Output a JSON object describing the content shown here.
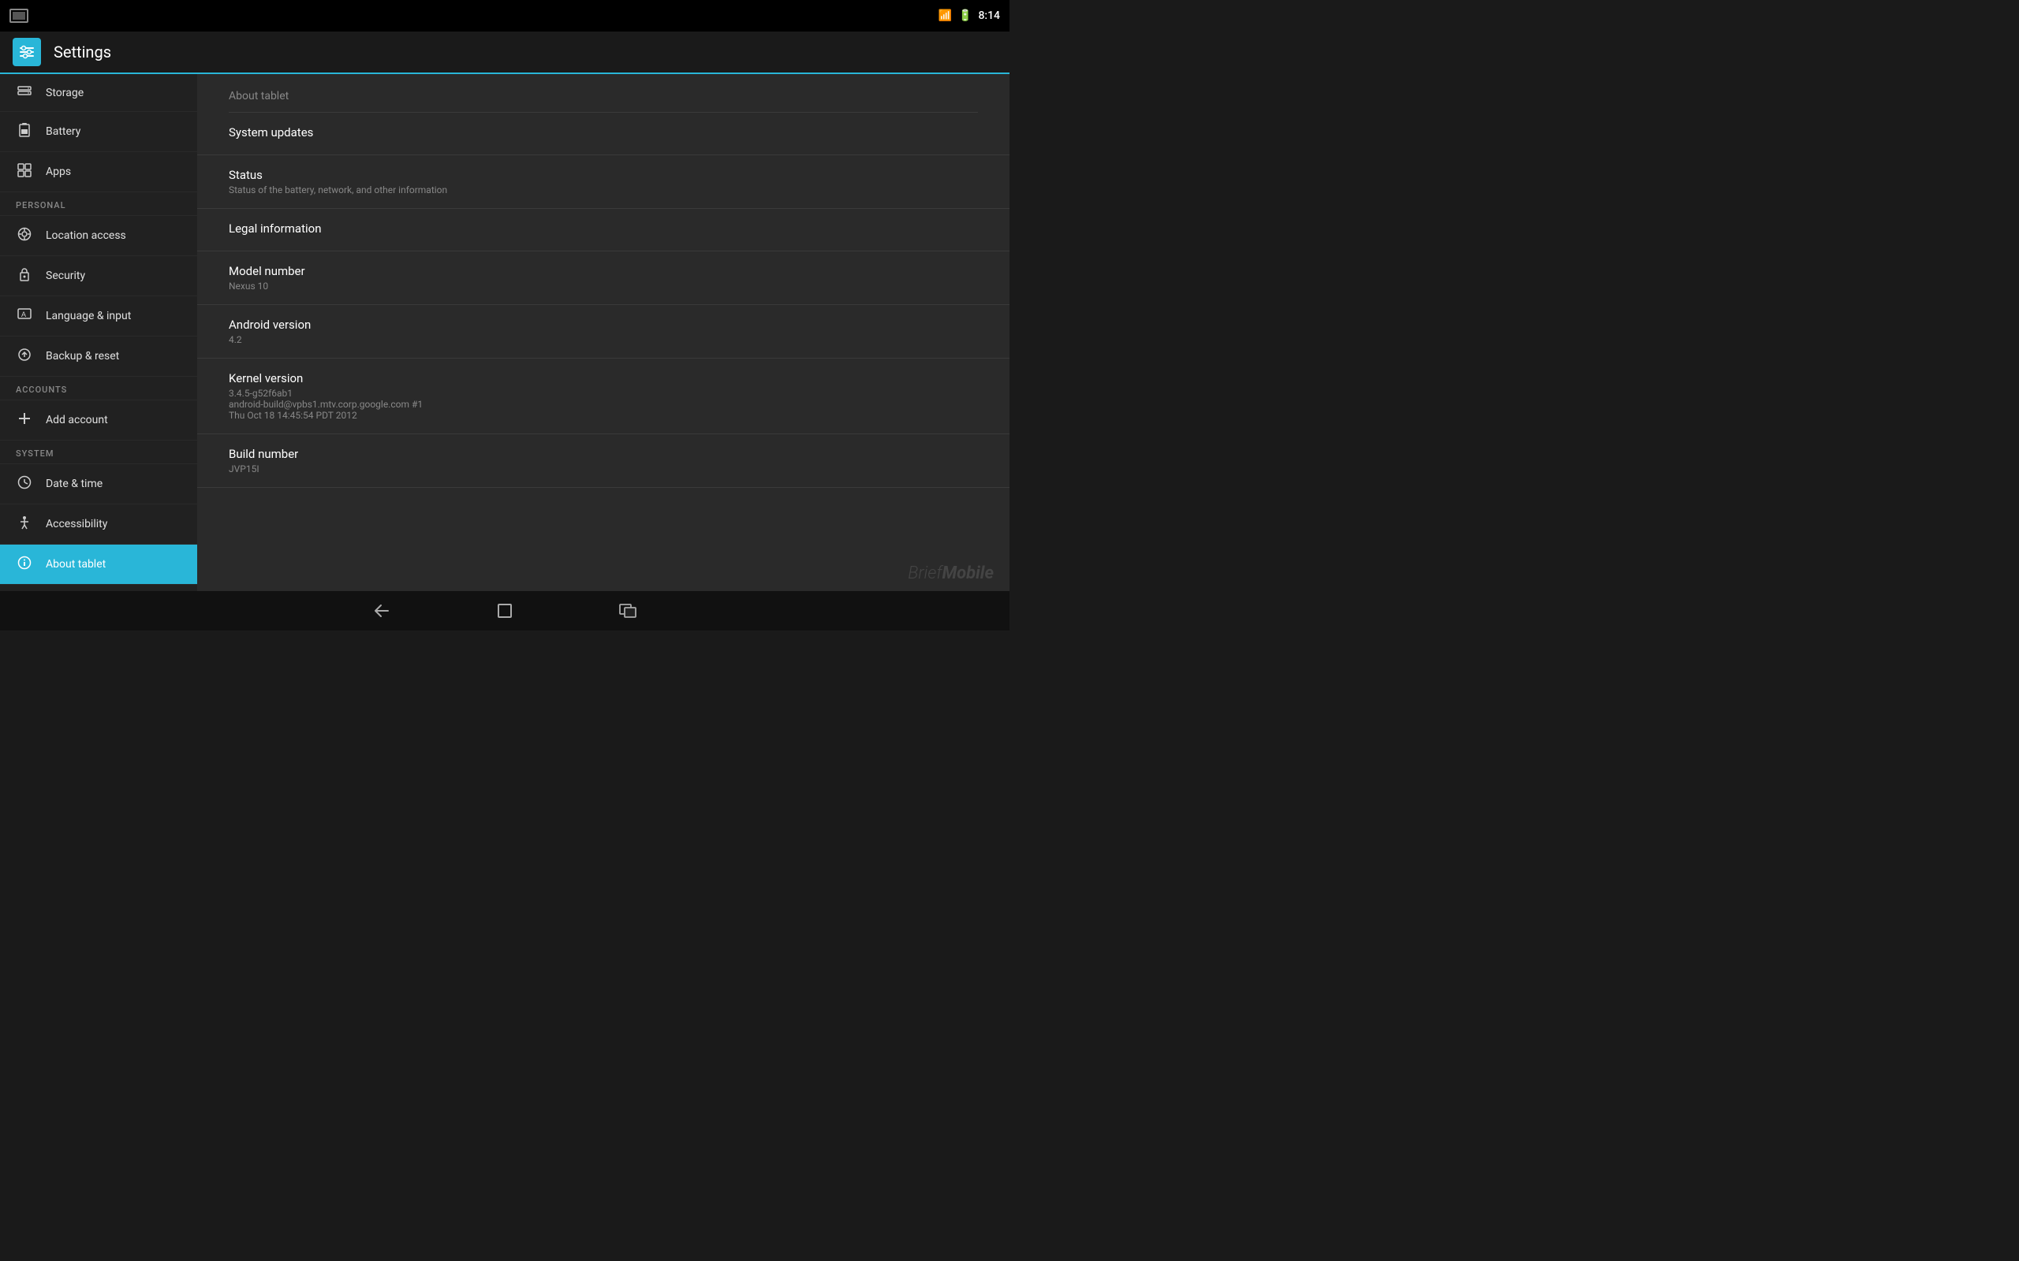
{
  "statusBar": {
    "time": "8:14"
  },
  "titleBar": {
    "appTitle": "Settings"
  },
  "sidebar": {
    "items": [
      {
        "id": "storage",
        "label": "Storage",
        "icon": "☰",
        "section": null
      },
      {
        "id": "battery",
        "label": "Battery",
        "icon": "▮",
        "section": null
      },
      {
        "id": "apps",
        "label": "Apps",
        "icon": "⊞",
        "section": null
      },
      {
        "id": "personal-header",
        "label": "PERSONAL",
        "isHeader": true
      },
      {
        "id": "location",
        "label": "Location access",
        "icon": "◎",
        "section": "personal"
      },
      {
        "id": "security",
        "label": "Security",
        "icon": "🔒",
        "section": "personal"
      },
      {
        "id": "language",
        "label": "Language & input",
        "icon": "A",
        "section": "personal"
      },
      {
        "id": "backup",
        "label": "Backup & reset",
        "icon": "↺",
        "section": "personal"
      },
      {
        "id": "accounts-header",
        "label": "ACCOUNTS",
        "isHeader": true
      },
      {
        "id": "add-account",
        "label": "Add account",
        "icon": "+",
        "section": "accounts"
      },
      {
        "id": "system-header",
        "label": "SYSTEM",
        "isHeader": true
      },
      {
        "id": "datetime",
        "label": "Date & time",
        "icon": "⏰",
        "section": "system"
      },
      {
        "id": "accessibility",
        "label": "Accessibility",
        "icon": "✋",
        "section": "system"
      },
      {
        "id": "about",
        "label": "About tablet",
        "icon": "ℹ",
        "section": "system",
        "active": true
      }
    ]
  },
  "contentPanel": {
    "title": "About tablet",
    "items": [
      {
        "id": "system-updates",
        "title": "System updates",
        "subtitle": null
      },
      {
        "id": "status",
        "title": "Status",
        "subtitle": "Status of the battery, network, and other information"
      },
      {
        "id": "legal-info",
        "title": "Legal information",
        "subtitle": null
      },
      {
        "id": "model-number",
        "title": "Model number",
        "subtitle": "Nexus 10"
      },
      {
        "id": "android-version",
        "title": "Android version",
        "subtitle": "4.2"
      },
      {
        "id": "kernel-version",
        "title": "Kernel version",
        "subtitle": "3.4.5-g52f6ab1\nandroid-build@vpbs1.mtv.corp.google.com #1\nThu Oct 18 14:45:54 PDT 2012"
      },
      {
        "id": "build-number",
        "title": "Build number",
        "subtitle": "JVP15I"
      }
    ]
  },
  "navBar": {
    "backLabel": "←",
    "homeLabel": "⌂",
    "recentLabel": "▭"
  },
  "watermark": {
    "part1": "Brief",
    "part2": "Mobile"
  }
}
